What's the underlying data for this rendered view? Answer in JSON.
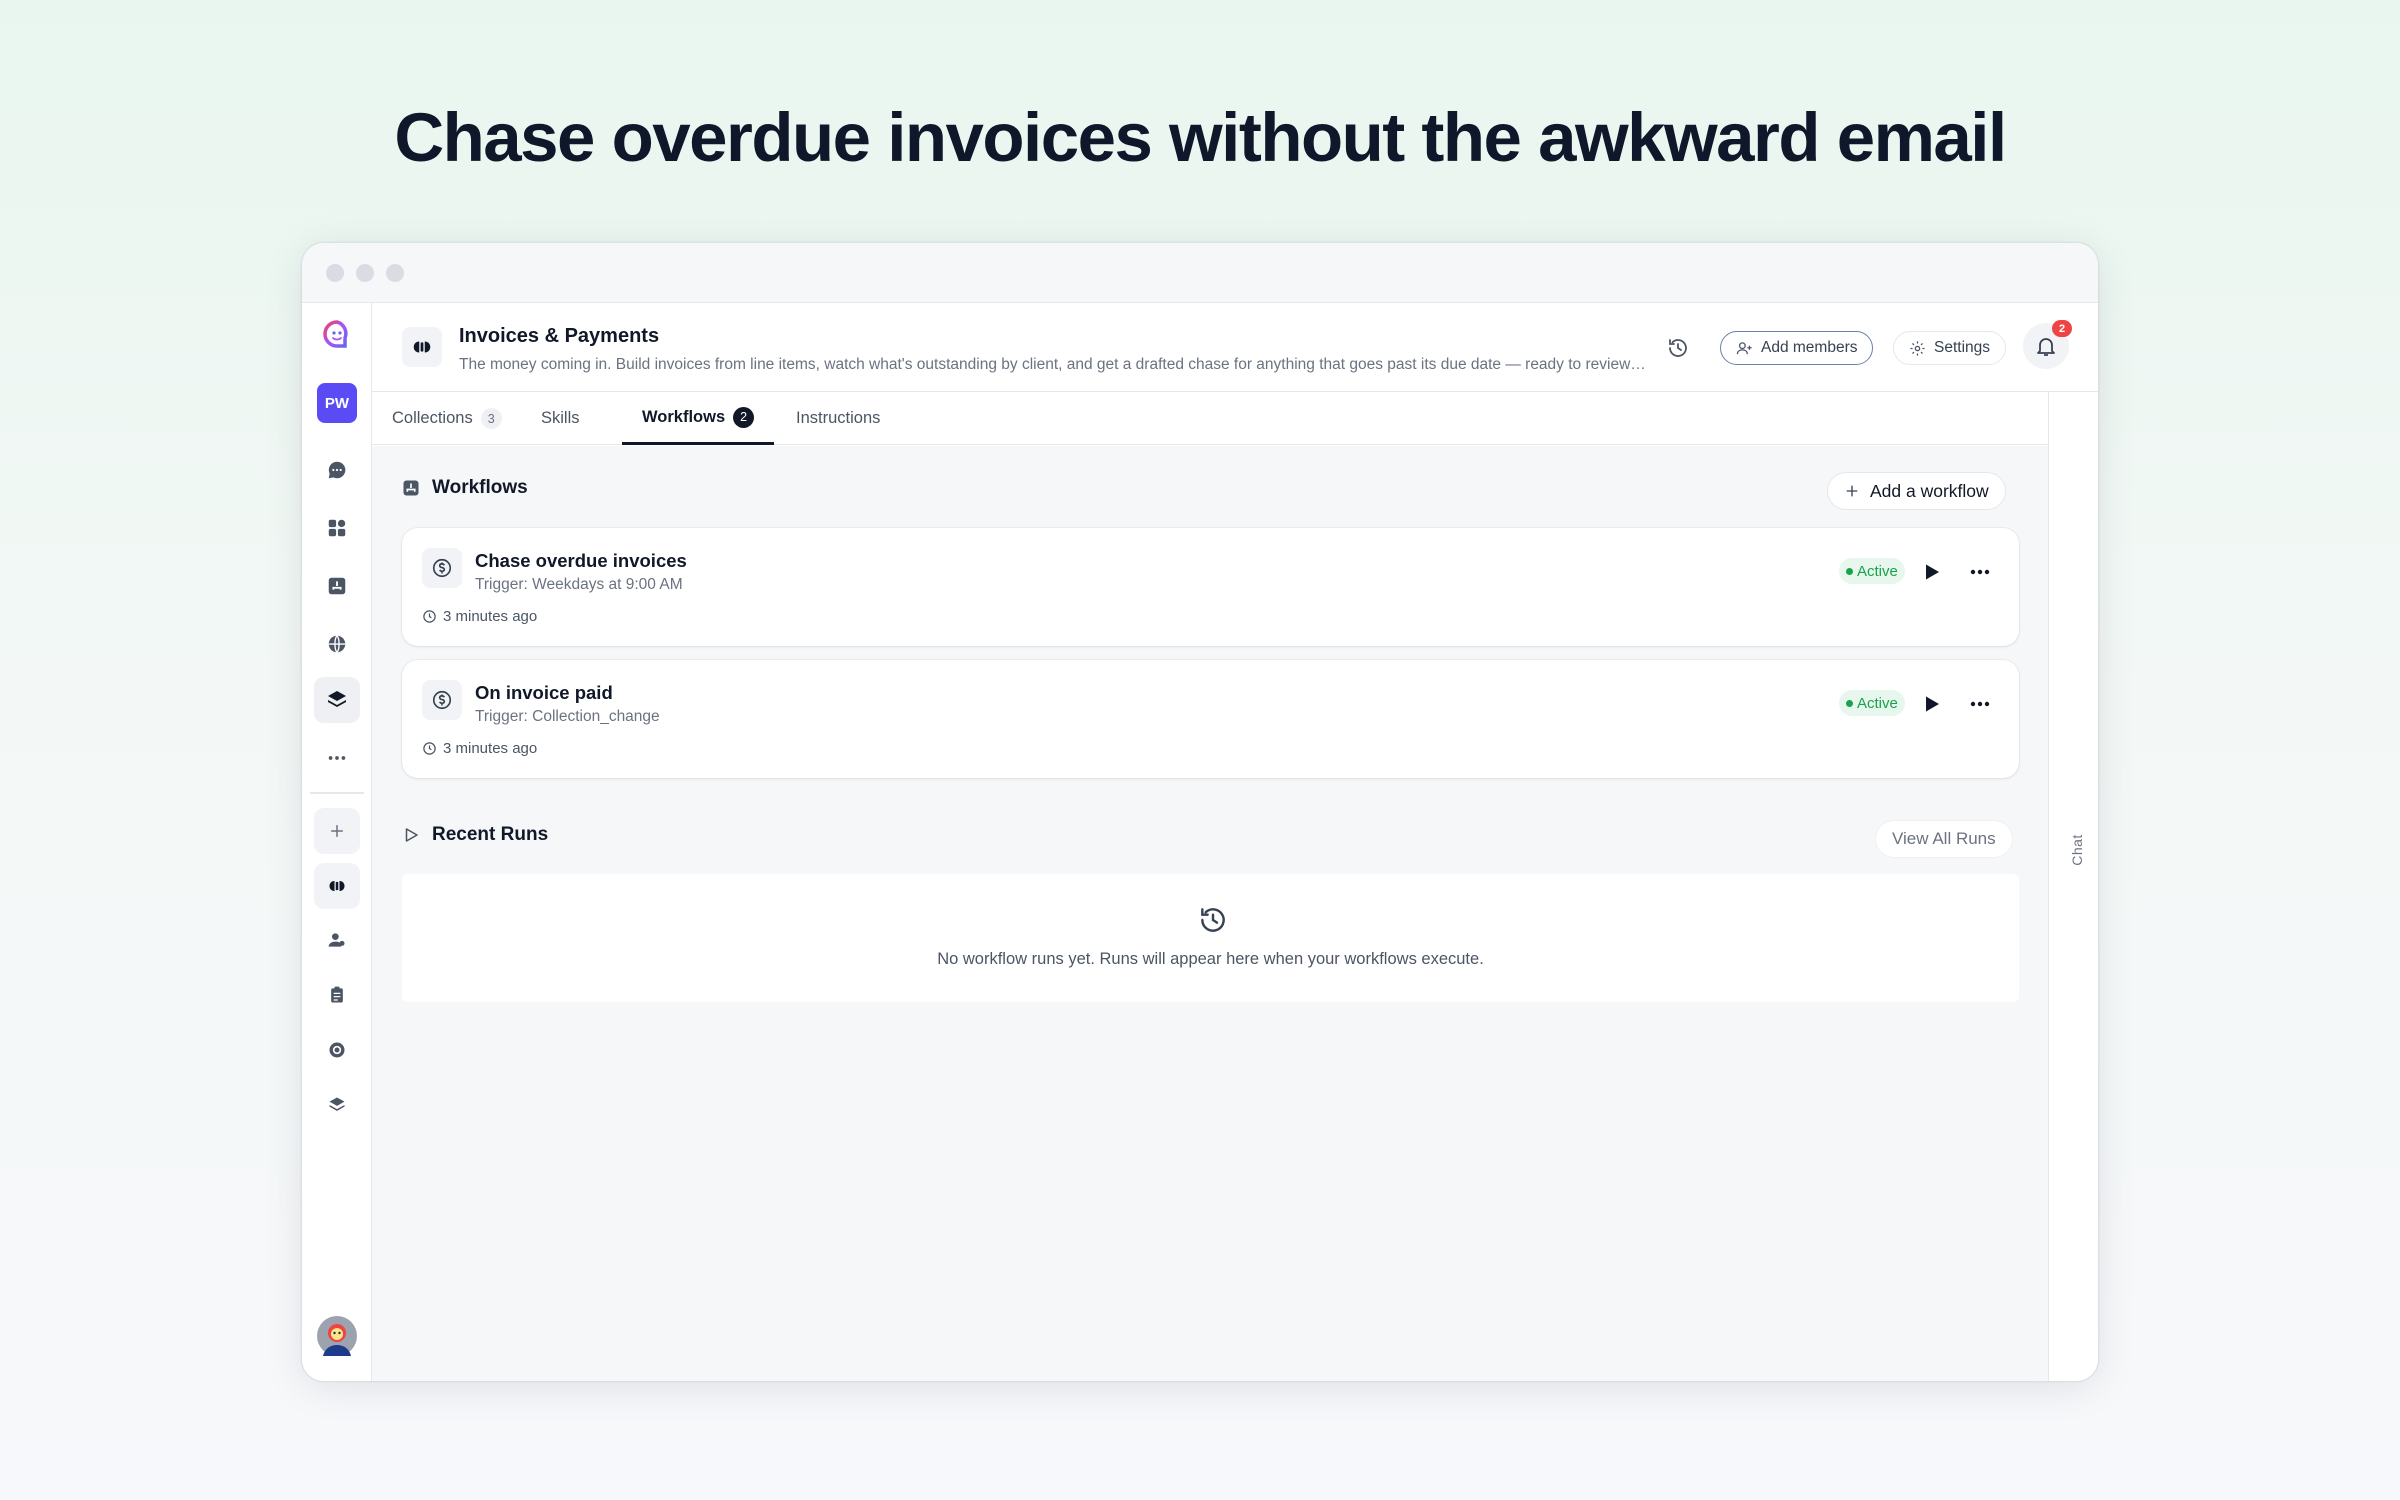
{
  "headline": "Chase overdue invoices without the awkward email",
  "sidebar": {
    "workspace_badge": "PW",
    "items": [
      {
        "name": "chat-icon"
      },
      {
        "name": "apps-grid-icon"
      },
      {
        "name": "workflow-icon"
      },
      {
        "name": "globe-icon"
      },
      {
        "name": "layers-icon",
        "selected": true
      },
      {
        "name": "more-icon"
      },
      {
        "name": "plus-icon"
      },
      {
        "name": "project-icon"
      },
      {
        "name": "person-icon"
      },
      {
        "name": "clipboard-icon"
      },
      {
        "name": "target-icon"
      },
      {
        "name": "stack-icon"
      }
    ]
  },
  "header": {
    "title": "Invoices & Payments",
    "description": "The money coming in. Build invoices from line items, watch what's outstanding by client, and get a drafted chase for anything that goes past its due date — ready to review and send.",
    "add_members_label": "Add members",
    "settings_label": "Settings",
    "notification_count": "2"
  },
  "tabs": [
    {
      "label": "Collections",
      "count": "3"
    },
    {
      "label": "Skills",
      "count": ""
    },
    {
      "label": "Workflows",
      "count": "2",
      "active": true
    },
    {
      "label": "Instructions",
      "count": ""
    }
  ],
  "workflows_section": {
    "title": "Workflows",
    "add_label": "Add a workflow",
    "items": [
      {
        "name": "Chase overdue invoices",
        "trigger": "Trigger: Weekdays at 9:00 AM",
        "updated": "3 minutes ago",
        "status": "Active"
      },
      {
        "name": "On invoice paid",
        "trigger": "Trigger: Collection_change",
        "updated": "3 minutes ago",
        "status": "Active"
      }
    ]
  },
  "recent_runs": {
    "title": "Recent Runs",
    "view_all_label": "View All Runs",
    "empty_text": "No workflow runs yet. Runs will appear here when your workflows execute."
  },
  "chat_rail_label": "Chat",
  "colors": {
    "accent": "#5b4bf5",
    "status_active": "#16a34a",
    "notification": "#ef4444"
  }
}
